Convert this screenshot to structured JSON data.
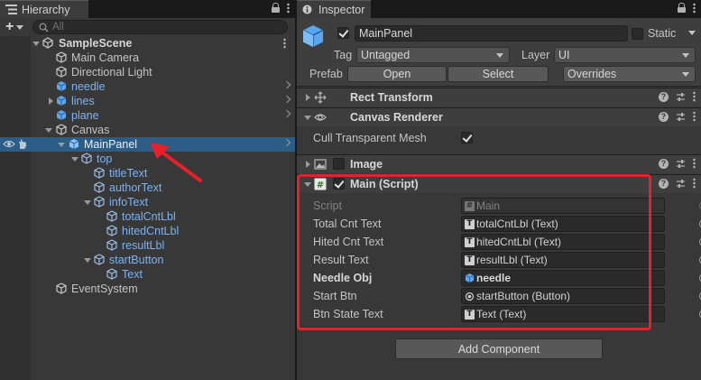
{
  "hierarchy": {
    "tab_label": "Hierarchy",
    "search_placeholder": "All",
    "items": [
      {
        "label": "SampleScene"
      },
      {
        "label": "Main Camera"
      },
      {
        "label": "Directional Light"
      },
      {
        "label": "needle"
      },
      {
        "label": "lines"
      },
      {
        "label": "plane"
      },
      {
        "label": "Canvas"
      },
      {
        "label": "MainPanel"
      },
      {
        "label": "top"
      },
      {
        "label": "titleText"
      },
      {
        "label": "authorText"
      },
      {
        "label": "infoText"
      },
      {
        "label": "totalCntLbl"
      },
      {
        "label": "hitedCntLbl"
      },
      {
        "label": "resultLbl"
      },
      {
        "label": "startButton"
      },
      {
        "label": "Text"
      },
      {
        "label": "EventSystem"
      }
    ]
  },
  "inspector": {
    "tab_label": "Inspector",
    "object_name": "MainPanel",
    "static_label": "Static",
    "tag_label": "Tag",
    "tag_value": "Untagged",
    "layer_label": "Layer",
    "layer_value": "UI",
    "prefab_label": "Prefab",
    "open_label": "Open",
    "select_label": "Select",
    "overrides_label": "Overrides",
    "components": [
      {
        "title": "Rect Transform"
      },
      {
        "title": "Canvas Renderer"
      },
      {
        "title": "Image"
      },
      {
        "title": "Main (Script)"
      }
    ],
    "cull_label": "Cull Transparent Mesh",
    "script_props": [
      {
        "label": "Script",
        "value": "Main"
      },
      {
        "label": "Total Cnt Text",
        "value": "totalCntLbl (Text)"
      },
      {
        "label": "Hited Cnt Text",
        "value": "hitedCntLbl (Text)"
      },
      {
        "label": "Result Text",
        "value": "resultLbl (Text)"
      },
      {
        "label": "Needle Obj",
        "value": "needle"
      },
      {
        "label": "Start Btn",
        "value": "startButton (Button)"
      },
      {
        "label": "Btn State Text",
        "value": "Text (Text)"
      }
    ],
    "add_component_label": "Add Component"
  },
  "colors": {
    "selection": "#2c5d87",
    "prefab_text": "#7cb3f2",
    "annotation_red": "#e8202a"
  }
}
